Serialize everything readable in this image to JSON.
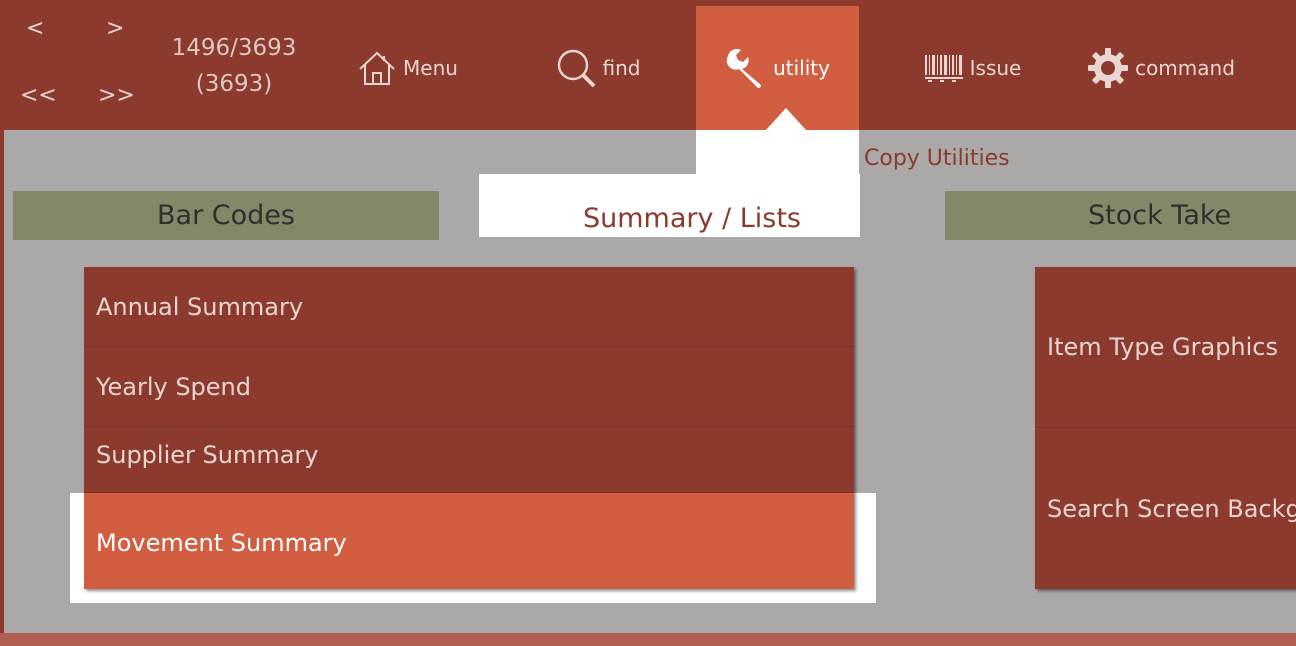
{
  "nav": {
    "prev": "<",
    "next": ">",
    "first": "<<",
    "last": ">>"
  },
  "record": {
    "position": "1496/3693",
    "total": "(3693)"
  },
  "toolbar": {
    "menu": "Menu",
    "find": "find",
    "utility": "utility",
    "issue": "Issue",
    "command": "command"
  },
  "subtab": {
    "copy_utilities": "Copy Utilities"
  },
  "categories": {
    "bar_codes": "Bar Codes",
    "summary_lists": "Summary / Lists",
    "stock_take": "Stock Take"
  },
  "summary_list": [
    "Annual Summary",
    "Yearly Spend",
    "Supplier Summary",
    "Movement Summary"
  ],
  "right_list": [
    "Item Type Graphics",
    "Search Screen Backg"
  ],
  "colors": {
    "header": "#8b3a2d",
    "accent": "#d25e42",
    "panel": "#aaa9a8",
    "olive": "#868768"
  },
  "icons": [
    "home-icon",
    "search-icon",
    "wrench-icon",
    "barcode-icon",
    "gear-icon"
  ]
}
